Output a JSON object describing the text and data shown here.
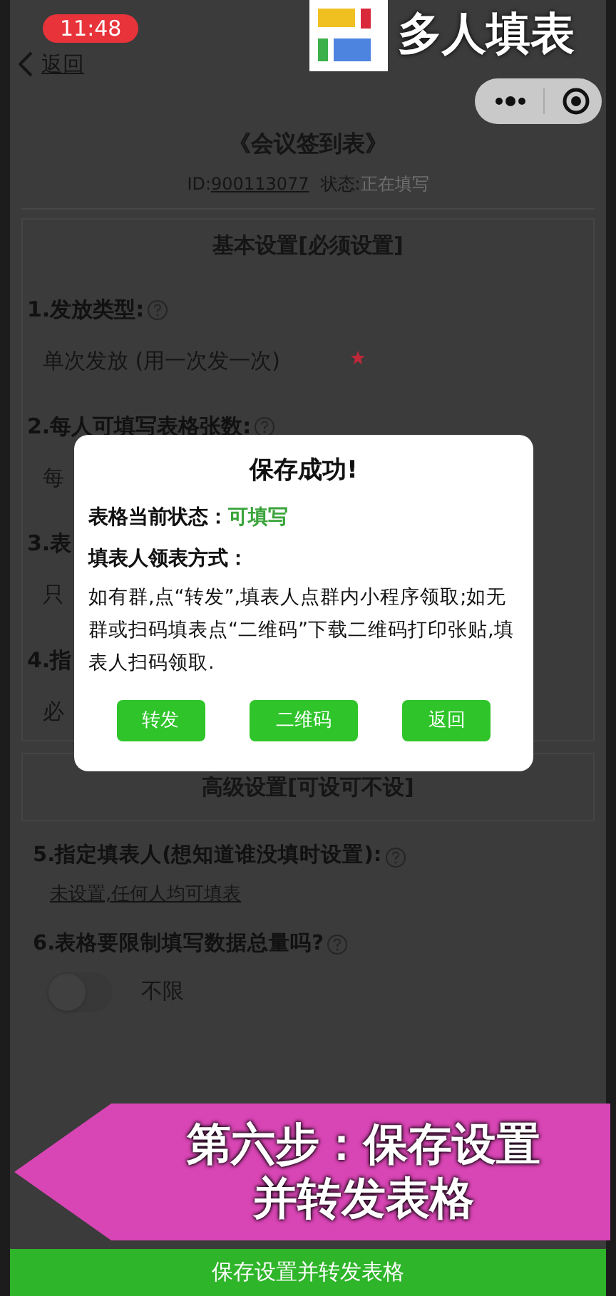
{
  "status_bar": {
    "time": "11:48"
  },
  "brand": {
    "name": "多人填表"
  },
  "nav": {
    "back": "返回"
  },
  "form": {
    "title": "《会议签到表》",
    "id_label": "ID:",
    "id": "900113077",
    "status_label": "状态:",
    "status": "正在填写"
  },
  "basic_section": {
    "heading": "基本设置[必须设置]",
    "items": [
      {
        "label": "1.发放类型:",
        "help": true,
        "value": "单次发放 (用一次发一次)",
        "required": true
      },
      {
        "label": "2.每人可填写表格张数:",
        "help": true,
        "value": "每"
      },
      {
        "label": "3.表",
        "value": "只"
      },
      {
        "label": "4.指",
        "value": "必"
      }
    ]
  },
  "advanced_section": {
    "heading": "高级设置[可设可不设]",
    "items": [
      {
        "kind": "link",
        "label": "5.指定填表人(想知道谁没填时设置):",
        "help": true,
        "value": "未设置,任何人均可填表"
      },
      {
        "kind": "toggle",
        "label": "6.表格要限制填写数据总量吗?",
        "help": true,
        "on": false,
        "value": "不限"
      }
    ]
  },
  "dialog": {
    "title": "保存成功!",
    "status_label": "表格当前状态：",
    "status": "可填写",
    "method_label": "填表人领表方式：",
    "instructions": "如有群,点“转发”,填表人点群内小程序领取;如无群或扫码填表点“二维码”下载二维码打印张贴,填表人扫码领取.",
    "buttons": [
      "转发",
      "二维码",
      "返回"
    ]
  },
  "tutorial_banner": {
    "lines": [
      "第六步：保存设置",
      "并转发表格"
    ]
  },
  "save_button": "保存设置并转发表格"
}
